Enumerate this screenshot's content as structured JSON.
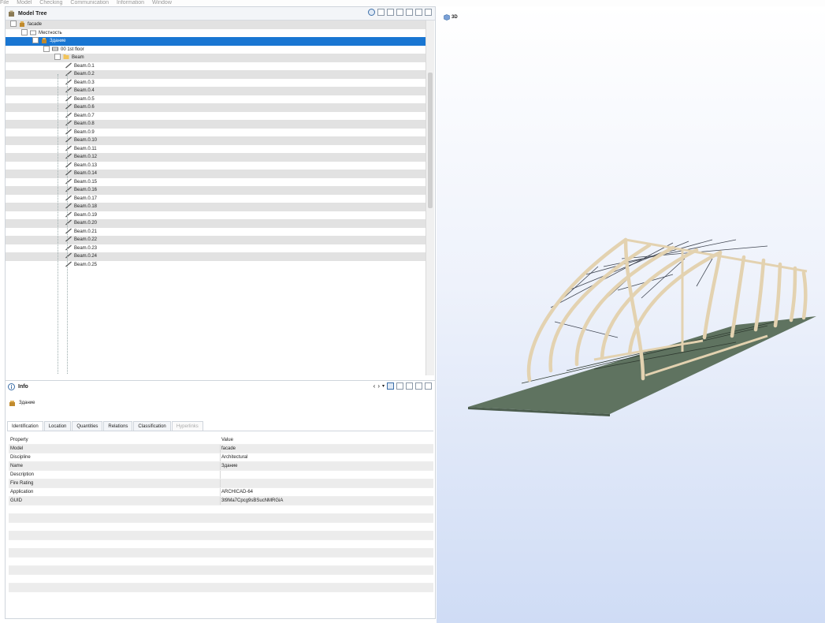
{
  "menubar": [
    "File",
    "Model",
    "Checking",
    "Communication",
    "Information",
    "Window"
  ],
  "model_tree": {
    "title": "Model Tree",
    "rows": [
      {
        "label": "facade",
        "level": 0,
        "icon": "building-icon"
      },
      {
        "label": "Местность",
        "level": 1,
        "icon": "site-icon"
      },
      {
        "label": "Здание",
        "level": 2,
        "icon": "building-icon",
        "selected": true
      },
      {
        "label": "00 1st floor",
        "level": 3,
        "icon": "storey-icon"
      },
      {
        "label": "Beam",
        "level": 4,
        "icon": "folder-icon"
      },
      {
        "label": "Beam.0.1",
        "level": 5,
        "icon": "beam-icon"
      },
      {
        "label": "Beam.0.2",
        "level": 5,
        "icon": "beam-icon"
      },
      {
        "label": "Beam.0.3",
        "level": 5,
        "icon": "beam-icon"
      },
      {
        "label": "Beam.0.4",
        "level": 5,
        "icon": "beam-icon"
      },
      {
        "label": "Beam.0.5",
        "level": 5,
        "icon": "beam-icon"
      },
      {
        "label": "Beam.0.6",
        "level": 5,
        "icon": "beam-icon"
      },
      {
        "label": "Beam.0.7",
        "level": 5,
        "icon": "beam-icon"
      },
      {
        "label": "Beam.0.8",
        "level": 5,
        "icon": "beam-icon"
      },
      {
        "label": "Beam.0.9",
        "level": 5,
        "icon": "beam-icon"
      },
      {
        "label": "Beam.0.10",
        "level": 5,
        "icon": "beam-icon"
      },
      {
        "label": "Beam.0.11",
        "level": 5,
        "icon": "beam-icon"
      },
      {
        "label": "Beam.0.12",
        "level": 5,
        "icon": "beam-icon"
      },
      {
        "label": "Beam.0.13",
        "level": 5,
        "icon": "beam-icon"
      },
      {
        "label": "Beam.0.14",
        "level": 5,
        "icon": "beam-icon"
      },
      {
        "label": "Beam.0.15",
        "level": 5,
        "icon": "beam-icon"
      },
      {
        "label": "Beam.0.16",
        "level": 5,
        "icon": "beam-icon"
      },
      {
        "label": "Beam.0.17",
        "level": 5,
        "icon": "beam-icon"
      },
      {
        "label": "Beam.0.18",
        "level": 5,
        "icon": "beam-icon"
      },
      {
        "label": "Beam.0.19",
        "level": 5,
        "icon": "beam-icon"
      },
      {
        "label": "Beam.0.20",
        "level": 5,
        "icon": "beam-icon"
      },
      {
        "label": "Beam.0.21",
        "level": 5,
        "icon": "beam-icon"
      },
      {
        "label": "Beam.0.22",
        "level": 5,
        "icon": "beam-icon"
      },
      {
        "label": "Beam.0.23",
        "level": 5,
        "icon": "beam-icon"
      },
      {
        "label": "Beam.0.24",
        "level": 5,
        "icon": "beam-icon"
      },
      {
        "label": "Beam.0.25",
        "level": 5,
        "icon": "beam-icon"
      }
    ],
    "toolbar_icons": [
      "filter-icon",
      "tree-view-icon",
      "list-view-icon",
      "expand-all-icon",
      "collapse-all-icon",
      "close-panel-icon",
      "maximize-icon"
    ]
  },
  "info": {
    "title": "Info",
    "object_name": "Здание",
    "nav_icons": [
      "back-icon",
      "forward-icon",
      "dropdown-icon",
      "sync-icon"
    ],
    "tabs": [
      {
        "label": "Identification",
        "state": "active"
      },
      {
        "label": "Location",
        "state": "normal"
      },
      {
        "label": "Quantities",
        "state": "normal"
      },
      {
        "label": "Relations",
        "state": "normal"
      },
      {
        "label": "Classification",
        "state": "normal"
      },
      {
        "label": "Hyperlinks",
        "state": "disabled"
      }
    ],
    "columns": {
      "property": "Property",
      "value": "Value"
    },
    "rows": [
      {
        "property": "Model",
        "value": "facade"
      },
      {
        "property": "Discipline",
        "value": "Architectural"
      },
      {
        "property": "Name",
        "value": "Здание"
      },
      {
        "property": "Description",
        "value": ""
      },
      {
        "property": "Fire Rating",
        "value": ""
      },
      {
        "property": "Application",
        "value": "ARCHICAD-64"
      },
      {
        "property": "GUID",
        "value": "3t9Ma7Cpcg9sBSucNMRGiA"
      }
    ]
  },
  "viewport": {
    "mode_label": "3D",
    "colors": {
      "ground": "#5f7360",
      "timber": "#e3d2b0",
      "steel": "#3f4551"
    }
  }
}
